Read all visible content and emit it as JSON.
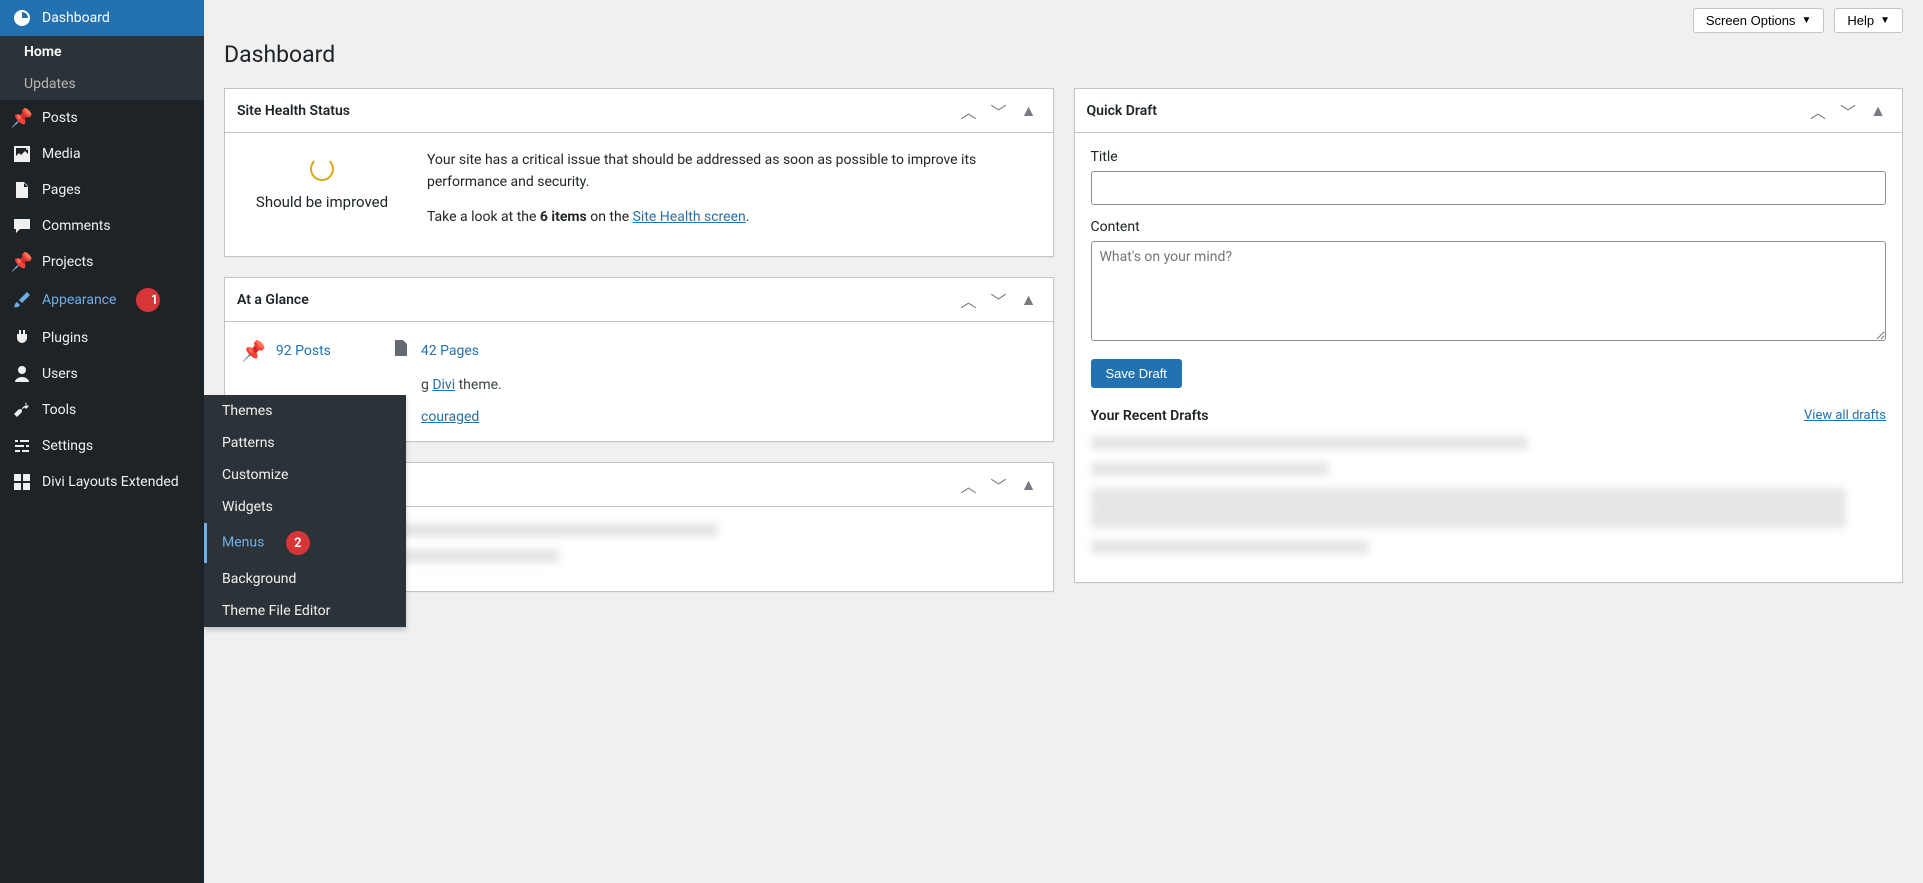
{
  "page_title": "Dashboard",
  "screen_options": "Screen Options",
  "help": "Help",
  "sidebar": {
    "dashboard": "Dashboard",
    "home": "Home",
    "updates": "Updates",
    "posts": "Posts",
    "media": "Media",
    "pages": "Pages",
    "comments": "Comments",
    "projects": "Projects",
    "appearance": "Appearance",
    "plugins": "Plugins",
    "users": "Users",
    "tools": "Tools",
    "settings": "Settings",
    "divi_layouts": "Divi Layouts Extended"
  },
  "appearance_submenu": {
    "themes": "Themes",
    "patterns": "Patterns",
    "customize": "Customize",
    "widgets": "Widgets",
    "menus": "Menus",
    "background": "Background",
    "theme_file_editor": "Theme File Editor"
  },
  "annotations": {
    "one": "1",
    "two": "2"
  },
  "site_health": {
    "title": "Site Health Status",
    "status": "Should be improved",
    "message": "Your site has a critical issue that should be addressed as soon as possible to improve its performance and security.",
    "take_look_pre": "Take a look at the ",
    "items_count": "6 items",
    "take_look_mid": " on the ",
    "screen_link": "Site Health screen",
    "period": "."
  },
  "at_a_glance": {
    "title": "At a Glance",
    "posts": "92 Posts",
    "pages": "42 Pages",
    "running_pre": "g ",
    "theme": "Divi",
    "running_post": " theme.",
    "discouraged": "couraged"
  },
  "quick_draft": {
    "title": "Quick Draft",
    "title_label": "Title",
    "content_label": "Content",
    "content_placeholder": "What's on your mind?",
    "save": "Save Draft",
    "recent": "Your Recent Drafts",
    "view_all": "View all drafts"
  }
}
